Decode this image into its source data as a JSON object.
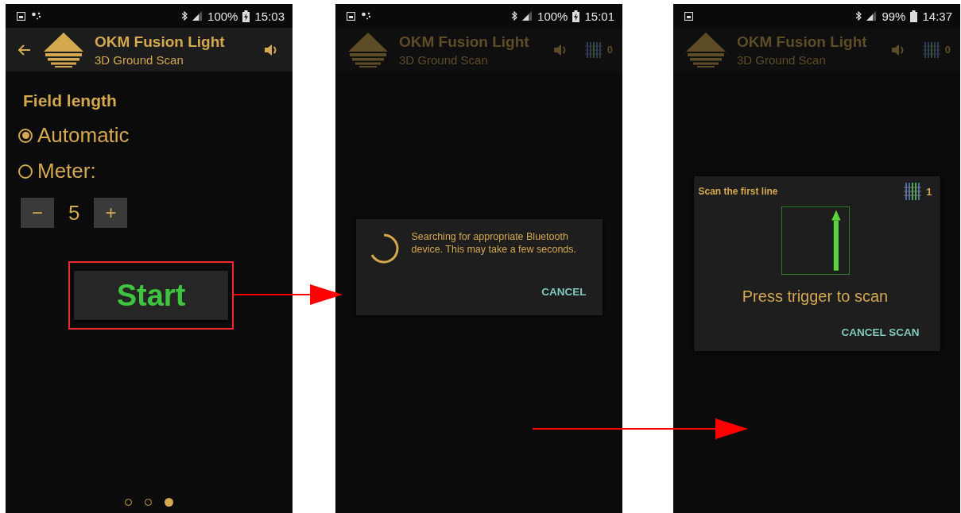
{
  "screens": [
    {
      "kind": "settings",
      "dimmed": false,
      "status_bar": {
        "notifications": [
          {
            "kind": "screenshot"
          },
          {
            "kind": "connection"
          }
        ],
        "battery": "100%",
        "charging": true,
        "time": "15:03"
      },
      "app_bar": {
        "back_button": true,
        "title": "OKM Fusion Light",
        "subtitle": "3D Ground Scan"
      },
      "heading": "Field length",
      "options": [
        {
          "label": "Automatic",
          "selected": true
        },
        {
          "label": "Meter:",
          "selected": false
        }
      ],
      "stepper": {
        "minus": "−",
        "value": "5",
        "plus": "+"
      },
      "start_button": {
        "label": "Start",
        "highlighted": true
      },
      "page_dots": [
        {
          "selected": false
        },
        {
          "selected": false
        },
        {
          "selected": true
        }
      ]
    },
    {
      "kind": "progress",
      "dimmed": true,
      "status_bar": {
        "notifications": [
          {
            "kind": "screenshot"
          },
          {
            "kind": "connection"
          }
        ],
        "battery": "100%",
        "charging": true,
        "time": "15:01"
      },
      "app_bar": {
        "back_button": false,
        "title": "OKM Fusion Light",
        "subtitle": "3D Ground Scan",
        "scan_count": "0"
      },
      "dialog": {
        "message": "Searching for appropriate Bluetooth device. This may take a few seconds.",
        "button": "CANCEL"
      }
    },
    {
      "kind": "scan",
      "dimmed": true,
      "status_bar": {
        "notifications": [
          {
            "kind": "screenshot"
          }
        ],
        "battery": "99%",
        "charging": false,
        "time": "14:37"
      },
      "app_bar": {
        "back_button": false,
        "title": "OKM Fusion Light",
        "subtitle": "3D Ground Scan",
        "scan_count": "0"
      },
      "dialog": {
        "title": "Scan the first line",
        "count": "1",
        "instruction": "Press trigger to scan",
        "button": "CANCEL SCAN"
      }
    }
  ]
}
